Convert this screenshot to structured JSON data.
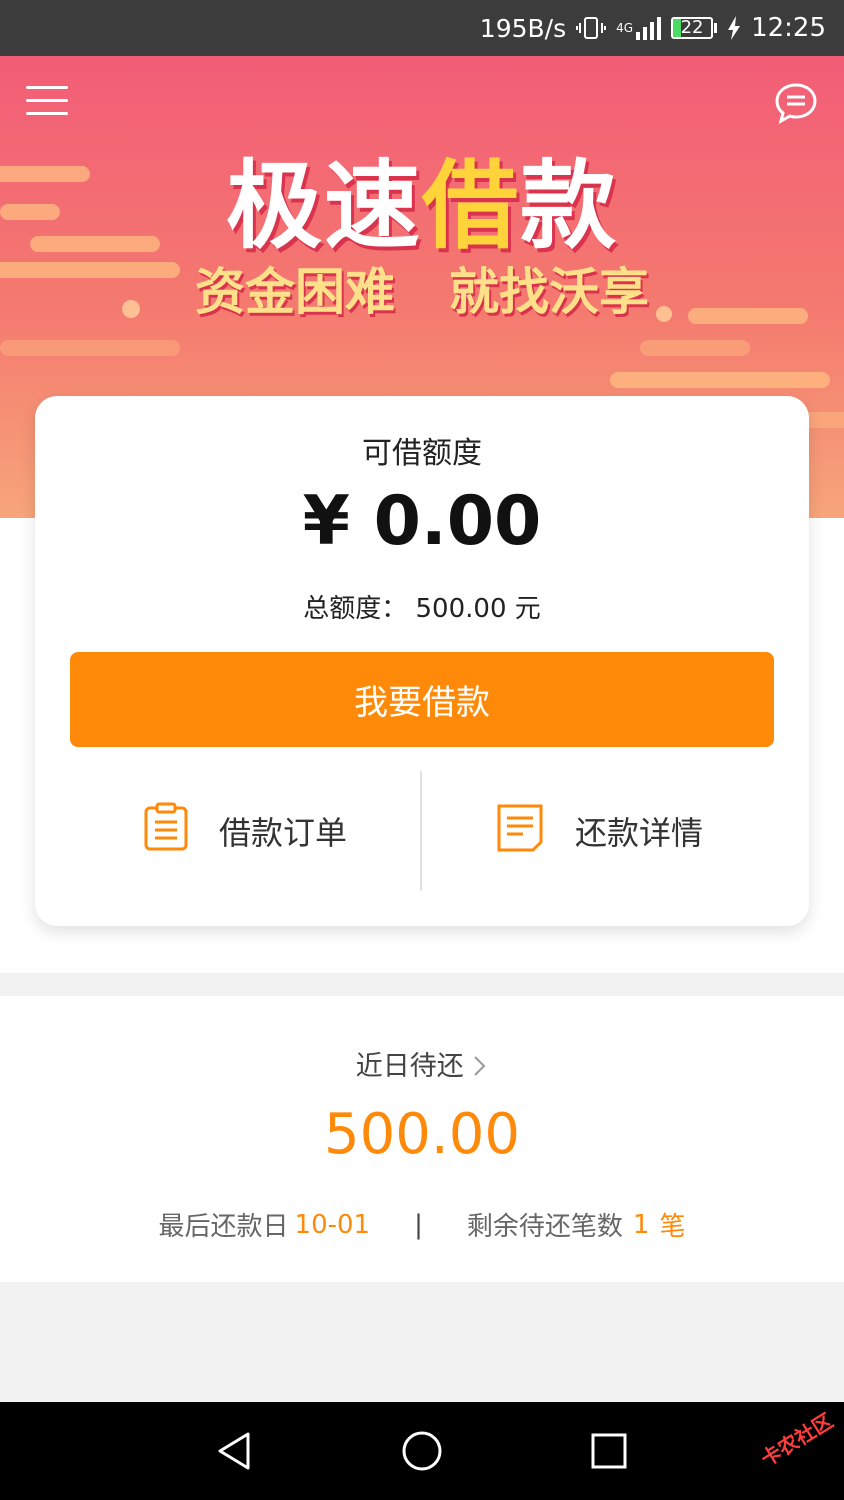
{
  "status_bar": {
    "net_speed": "195B/s",
    "signal_label": "4G",
    "battery": "22",
    "battery_level": 0.22,
    "time": "12:25"
  },
  "banner": {
    "title": "极速借款",
    "title_highlight": "借",
    "subtitle_left": "资金困难",
    "subtitle_right": "就找沃享"
  },
  "card": {
    "available_label": "可借额度",
    "available_amount": "¥ 0.00",
    "total_label": "总额度：",
    "total_value": "500.00 元",
    "borrow_button": "我要借款",
    "orders_label": "借款订单",
    "repay_detail_label": "还款详情"
  },
  "repayment": {
    "title": "近日待还",
    "amount": "500.00",
    "last_date_label": "最后还款日",
    "last_date_value": "10-01",
    "separator": "|",
    "remaining_label": "剩余待还笔数",
    "remaining_count": "1",
    "remaining_unit": "笔"
  },
  "watermark": "卡农社区",
  "colors": {
    "accent": "#ff8a0a",
    "banner_top": "#f25d77",
    "banner_bottom": "#f7a57a"
  },
  "icons": [
    "menu-icon",
    "message-icon",
    "clipboard-icon",
    "document-icon",
    "chevron-right-icon",
    "back-icon",
    "home-icon",
    "recents-icon"
  ]
}
